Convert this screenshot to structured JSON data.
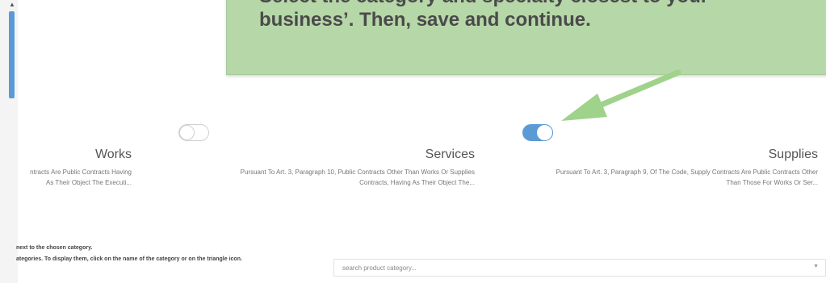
{
  "callout": {
    "line1": "Select the category and specialty closest to your",
    "line2": "business’. Then, save and continue."
  },
  "categories": [
    {
      "title": "Works",
      "desc1": "ntracts Are Public Contracts Having",
      "desc2": "As Their Object The Executi...",
      "selected": false
    },
    {
      "title": "Services",
      "desc1": "Pursuant To Art. 3, Paragraph 10, Public Contracts Other Than Works Or Supplies",
      "desc2": "Contracts, Having As Their Object The...",
      "selected": false
    },
    {
      "title": "Supplies",
      "desc1": "Pursuant To Art. 3, Paragraph 9, Of The Code, Supply Contracts Are Public Contracts Other",
      "desc2": "Than Those For Works Or Ser...",
      "selected": true
    }
  ],
  "instructions": {
    "line1": "next to the chosen category.",
    "line2": "ategories. To display them, click on the name of the category or on the triangle icon."
  },
  "search": {
    "placeholder": "search product category..."
  },
  "colors": {
    "callout_bg": "#b6d7a8",
    "arrow": "#9fd28a",
    "toggle_on": "#5b9bd5",
    "scroll_thumb": "#5b9bd5"
  },
  "icons": {
    "scroll_up": "triangle-up",
    "search_caret": "chevron-down"
  }
}
